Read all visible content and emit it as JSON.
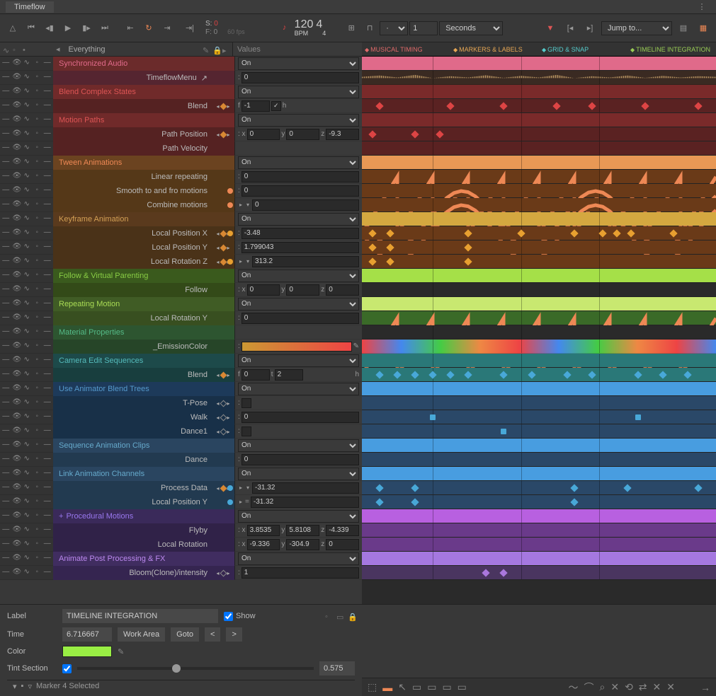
{
  "title": "Timeflow",
  "transport": {
    "frame_s": "0",
    "frame_f": "0",
    "fps": "60 fps",
    "bpm": "120",
    "sig": "4",
    "sig_denom": "4",
    "time_number": "1",
    "time_unit": "Seconds",
    "jump": "Jump to..."
  },
  "outliner": {
    "filter": "Everything",
    "values_label": "Values"
  },
  "tracks": [
    {
      "type": "h",
      "name": "Synchronized Audio",
      "color": "red1",
      "val": {
        "kind": "select",
        "v": "On"
      }
    },
    {
      "type": "p",
      "name": "TimeflowMenu",
      "color": "red1s",
      "val": {
        "kind": "txt",
        "pre": ":",
        "v": "0"
      },
      "rightIcon": "↗"
    },
    {
      "type": "h",
      "name": "Blend Complex States",
      "color": "red3",
      "val": {
        "kind": "select",
        "v": "On"
      }
    },
    {
      "type": "p",
      "name": "Blend",
      "color": "red3s",
      "key": true,
      "val": {
        "kind": "fh",
        "f": "-1",
        "h": "h",
        "chk": true
      }
    },
    {
      "type": "h",
      "name": "Motion Paths",
      "color": "red3",
      "val": {
        "kind": "select",
        "v": "On"
      }
    },
    {
      "type": "p",
      "name": "Path Position",
      "color": "red3s",
      "key": true,
      "val": {
        "kind": "xyz",
        "x": "0",
        "y": "0",
        "z": "-9.3"
      }
    },
    {
      "type": "p",
      "name": "Path Velocity",
      "color": "red3s",
      "val": {
        "kind": "none"
      }
    },
    {
      "type": "h",
      "name": "Tween Animations",
      "color": "org1",
      "val": {
        "kind": "select",
        "v": "On"
      }
    },
    {
      "type": "p",
      "name": "Linear repeating",
      "color": "org1s",
      "val": {
        "kind": "txt",
        "pre": ":",
        "v": "0"
      }
    },
    {
      "type": "p",
      "name": "Smooth to and fro motions",
      "color": "org1s",
      "val": {
        "kind": "txt",
        "pre": ":",
        "v": "0"
      },
      "dot": "#e85"
    },
    {
      "type": "p",
      "name": "Combine motions",
      "color": "org1s",
      "val": {
        "kind": "chevtxt",
        "v": "0"
      },
      "dot": "#e85"
    },
    {
      "type": "h",
      "name": "Keyframe Animation",
      "color": "org2",
      "val": {
        "kind": "select",
        "v": "On"
      }
    },
    {
      "type": "p",
      "name": "Local Position X",
      "color": "org2s",
      "key": true,
      "val": {
        "kind": "txt",
        "pre": ":",
        "v": "-3.48"
      },
      "dot": "#e8a030"
    },
    {
      "type": "p",
      "name": "Local Position Y",
      "color": "org2s",
      "key": true,
      "val": {
        "kind": "txt",
        "pre": ":",
        "v": "1.799043"
      }
    },
    {
      "type": "p",
      "name": "Local Rotation Z",
      "color": "org2s",
      "key": true,
      "val": {
        "kind": "chevtxt",
        "v": "313.2"
      },
      "dot": "#e8a030"
    },
    {
      "type": "h",
      "name": "Follow & Virtual Parenting",
      "color": "grn1",
      "val": {
        "kind": "select",
        "v": "On"
      }
    },
    {
      "type": "p",
      "name": "Follow",
      "color": "grn1s",
      "val": {
        "kind": "xyz",
        "x": "0",
        "y": "0",
        "z": "0"
      }
    },
    {
      "type": "h",
      "name": "Repeating Motion",
      "color": "grn2",
      "val": {
        "kind": "select",
        "v": "On"
      }
    },
    {
      "type": "p",
      "name": "Local Rotation Y",
      "color": "grn2s",
      "val": {
        "kind": "txt",
        "pre": ":",
        "v": "0"
      }
    },
    {
      "type": "h",
      "name": "Material Properties",
      "color": "grn3",
      "val": {
        "kind": "none"
      }
    },
    {
      "type": "p",
      "name": "_EmissionColor",
      "color": "grn3s",
      "val": {
        "kind": "swatch"
      }
    },
    {
      "type": "h",
      "name": "Camera Edit Sequences",
      "color": "teal",
      "val": {
        "kind": "select",
        "v": "On"
      }
    },
    {
      "type": "p",
      "name": "Blend",
      "color": "teals",
      "key": true,
      "val": {
        "kind": "ft",
        "f": "0",
        "t": "2",
        "h": "h"
      }
    },
    {
      "type": "h",
      "name": "Use Animator Blend Trees",
      "color": "blu1",
      "val": {
        "kind": "select",
        "v": "On"
      }
    },
    {
      "type": "p",
      "name": "T-Pose",
      "color": "blu1s",
      "keyEmpty": true,
      "val": {
        "kind": "chk",
        "v": false
      }
    },
    {
      "type": "p",
      "name": "Walk",
      "color": "blu1s",
      "keyEmpty": true,
      "val": {
        "kind": "txt",
        "pre": ":",
        "v": "0"
      }
    },
    {
      "type": "p",
      "name": "Dance1",
      "color": "blu1s",
      "keyEmpty": true,
      "val": {
        "kind": "chk",
        "v": false
      }
    },
    {
      "type": "h",
      "name": "Sequence Animation Clips",
      "color": "blu3",
      "val": {
        "kind": "select",
        "v": "On"
      }
    },
    {
      "type": "p",
      "name": "Dance",
      "color": "blu3s",
      "val": {
        "kind": "txt",
        "pre": ":",
        "v": "0"
      }
    },
    {
      "type": "h",
      "name": "Link Animation Channels",
      "color": "blu3",
      "val": {
        "kind": "select",
        "v": "On"
      }
    },
    {
      "type": "p",
      "name": "Process Data",
      "color": "blu3s",
      "key": true,
      "val": {
        "kind": "chevtxt",
        "v": "-31.32"
      },
      "dot": "#48a8d8"
    },
    {
      "type": "p",
      "name": "Local Position Y",
      "color": "blu3s",
      "val": {
        "kind": "eqtxt",
        "v": "-31.32"
      },
      "dot": "#48a8d8"
    },
    {
      "type": "h",
      "name": "Procedural Motions",
      "color": "pur1",
      "pre": "+",
      "val": {
        "kind": "select",
        "v": "On"
      }
    },
    {
      "type": "p",
      "name": "Flyby",
      "color": "pur1s",
      "val": {
        "kind": "xyz",
        "x": "3.8535",
        "y": "5.8108",
        "z": "-4.339"
      }
    },
    {
      "type": "p",
      "name": "Local Rotation",
      "color": "pur1s",
      "val": {
        "kind": "xyz",
        "x": "-9.336",
        "y": "-304.9",
        "z": "0"
      }
    },
    {
      "type": "h",
      "name": "Animate Post Processing & FX",
      "color": "pur3",
      "val": {
        "kind": "select",
        "v": "On"
      }
    },
    {
      "type": "p",
      "name": "Bloom(Clone)/intensity",
      "color": "pur3s",
      "keyEmpty": true,
      "val": {
        "kind": "txt",
        "pre": ":",
        "v": "1"
      }
    }
  ],
  "timeline": {
    "markers": [
      "MUSICAL TIMING",
      "MARKERS & LABELS",
      "GRID & SNAP",
      "TIMELINE INTEGRATION"
    ],
    "marker_colors": [
      "m-red",
      "m-org",
      "m-teal",
      "m-grn"
    ]
  },
  "footer": {
    "label_lbl": "Label",
    "label_val": "TIMELINE INTEGRATION",
    "show_lbl": "Show",
    "time_lbl": "Time",
    "time_val": "6.716667",
    "workarea": "Work Area",
    "goto": "Goto",
    "prev": "<",
    "next": ">",
    "color_lbl": "Color",
    "tint_lbl": "Tint Section",
    "tint_val": "0.575",
    "status": "Marker 4 Selected"
  }
}
